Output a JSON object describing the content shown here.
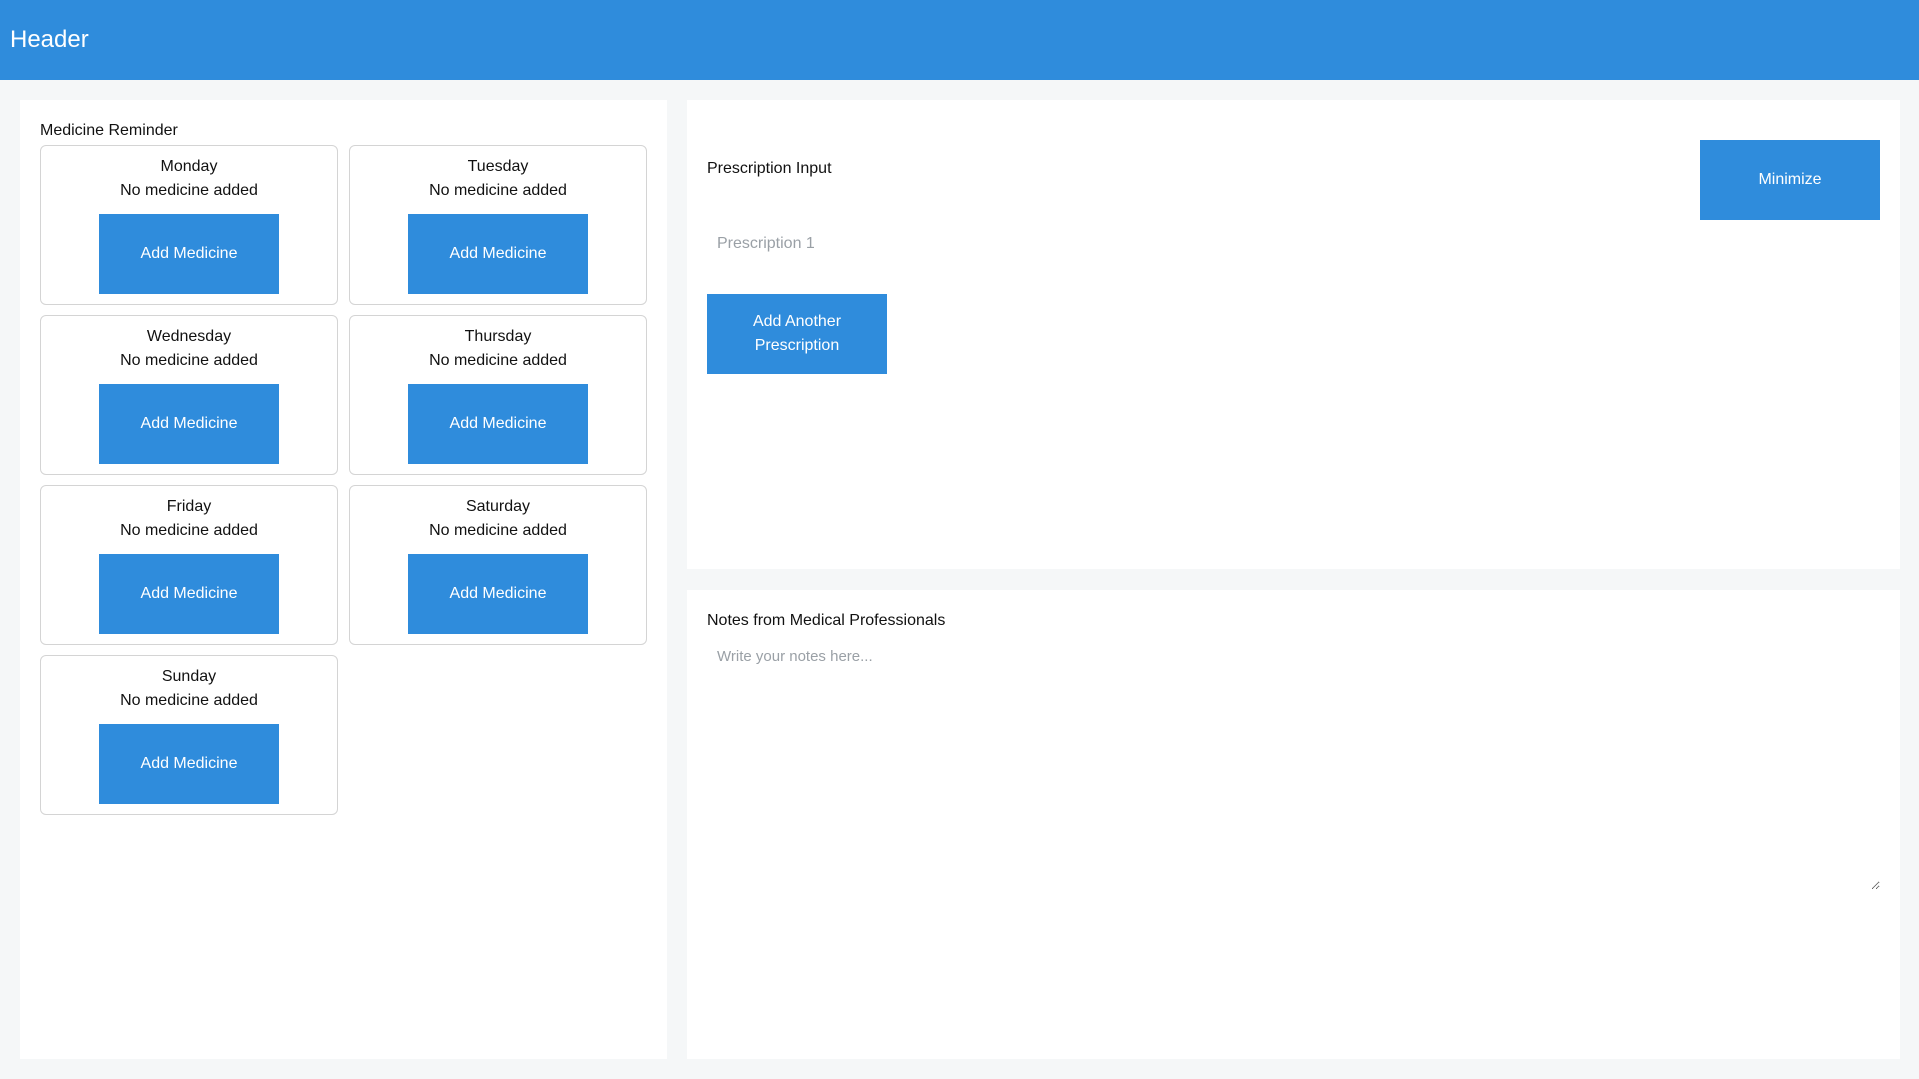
{
  "header": {
    "title": "Header"
  },
  "reminder": {
    "title": "Medicine Reminder",
    "days": [
      {
        "name": "Monday",
        "status": "No medicine added",
        "button": "Add Medicine"
      },
      {
        "name": "Tuesday",
        "status": "No medicine added",
        "button": "Add Medicine"
      },
      {
        "name": "Wednesday",
        "status": "No medicine added",
        "button": "Add Medicine"
      },
      {
        "name": "Thursday",
        "status": "No medicine added",
        "button": "Add Medicine"
      },
      {
        "name": "Friday",
        "status": "No medicine added",
        "button": "Add Medicine"
      },
      {
        "name": "Saturday",
        "status": "No medicine added",
        "button": "Add Medicine"
      },
      {
        "name": "Sunday",
        "status": "No medicine added",
        "button": "Add Medicine"
      }
    ]
  },
  "prescription": {
    "title": "Prescription Input",
    "minimize_label": "Minimize",
    "input_value": "",
    "input_placeholder": "Prescription 1",
    "add_label": "Add Another Prescription"
  },
  "notes": {
    "title": "Notes from Medical Professionals",
    "value": "",
    "placeholder": "Write your notes here..."
  },
  "colors": {
    "accent": "#2f8cdc",
    "background": "#f5f7f8",
    "panel": "#ffffff",
    "card_border": "#d4d4d4"
  }
}
